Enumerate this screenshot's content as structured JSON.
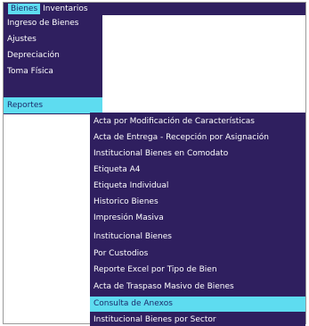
{
  "menubar": {
    "items": [
      {
        "label": "Bienes",
        "active": true
      },
      {
        "label": "Inventarios",
        "active": false
      }
    ]
  },
  "bienes_menu": {
    "items": [
      {
        "label": "Ingreso de Bienes",
        "active": false
      },
      {
        "label": "Ajustes",
        "active": false
      },
      {
        "label": "Depreciación",
        "active": false
      },
      {
        "label": "Toma Física",
        "active": false
      },
      {
        "label": "Reportes",
        "active": true
      }
    ]
  },
  "reportes_menu": {
    "items": [
      {
        "label": "Acta por Modificación de Características",
        "active": false
      },
      {
        "label": "Acta de Entrega - Recepción por Asignación",
        "active": false
      },
      {
        "label": "Institucional Bienes en Comodato",
        "active": false
      },
      {
        "label": "Etiqueta A4",
        "active": false
      },
      {
        "label": "Etiqueta Individual",
        "active": false
      },
      {
        "label": "Historico Bienes",
        "active": false
      },
      {
        "label": "Impresión Masiva",
        "active": false
      },
      {
        "label": "Institucional Bienes",
        "active": false
      },
      {
        "label": "Por Custodios",
        "active": false
      },
      {
        "label": "Reporte Excel por Tipo de Bien",
        "active": false
      },
      {
        "label": "Acta de Traspaso Masivo de Bienes",
        "active": false
      },
      {
        "label": "Consulta de Anexos",
        "active": true
      },
      {
        "label": "Institucional Bienes por Sector",
        "active": false
      }
    ]
  },
  "colors": {
    "menu_background": "#2f1f5f",
    "highlight": "#5edcf0",
    "highlight_text": "#1b2a6b",
    "text": "#ffffff"
  }
}
